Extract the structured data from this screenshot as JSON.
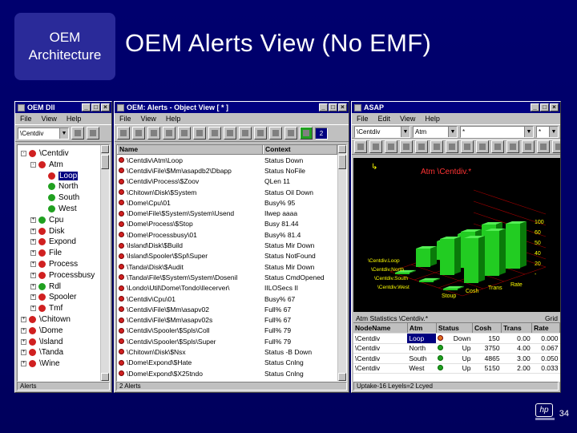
{
  "slide": {
    "architecture_box": [
      "OEM",
      "Architecture"
    ],
    "title": "OEM Alerts View (No EMF)",
    "page_number": "34"
  },
  "win_dll": {
    "title": "OEM Dll",
    "menu": [
      "File",
      "View",
      "Help"
    ],
    "combo": "\\Centdiv",
    "tree": [
      {
        "label": "\\Centdiv",
        "depth": 0,
        "expander": "-",
        "color": "#d02020"
      },
      {
        "label": "Atm",
        "depth": 1,
        "expander": "-",
        "color": "#d02020"
      },
      {
        "label": "Loop",
        "depth": 2,
        "color": "#d02020",
        "selected": true
      },
      {
        "label": "North",
        "depth": 2,
        "color": "#20a020"
      },
      {
        "label": "South",
        "depth": 2,
        "color": "#20a020"
      },
      {
        "label": "West",
        "depth": 2,
        "color": "#20a020"
      },
      {
        "label": "Cpu",
        "depth": 1,
        "expander": "+",
        "color": "#20a020"
      },
      {
        "label": "Disk",
        "depth": 1,
        "expander": "+",
        "color": "#d02020"
      },
      {
        "label": "Expond",
        "depth": 1,
        "expander": "+",
        "color": "#d02020"
      },
      {
        "label": "File",
        "depth": 1,
        "expander": "+",
        "color": "#d02020"
      },
      {
        "label": "Process",
        "depth": 1,
        "expander": "+",
        "color": "#d02020"
      },
      {
        "label": "Processbusy",
        "depth": 1,
        "expander": "+",
        "color": "#d02020"
      },
      {
        "label": "Rdl",
        "depth": 1,
        "expander": "+",
        "color": "#20a020"
      },
      {
        "label": "Spooler",
        "depth": 1,
        "expander": "+",
        "color": "#d02020"
      },
      {
        "label": "Tmf",
        "depth": 1,
        "expander": "+",
        "color": "#d02020"
      },
      {
        "label": "\\Chitown",
        "depth": 0,
        "expander": "+",
        "color": "#d02020"
      },
      {
        "label": "\\Dome",
        "depth": 0,
        "expander": "+",
        "color": "#d02020"
      },
      {
        "label": "\\Island",
        "depth": 0,
        "expander": "+",
        "color": "#d02020"
      },
      {
        "label": "\\Tanda",
        "depth": 0,
        "expander": "+",
        "color": "#d02020"
      },
      {
        "label": "\\Wine",
        "depth": 0,
        "expander": "+",
        "color": "#d02020"
      }
    ],
    "status": "Alerts"
  },
  "win_alerts": {
    "title": "OEM: Alerts - Object View [ * ]",
    "menu": [
      "File",
      "View",
      "Help"
    ],
    "toolbar_counter": "2",
    "columns": [
      "Name",
      "Context"
    ],
    "rows": [
      [
        "\\Centdiv\\Atm\\Loop",
        "Status Down"
      ],
      [
        "\\Centdiv\\File\\$Mm\\asapdb2\\Dbapp",
        "Status NoFile"
      ],
      [
        "\\Centdiv\\Process\\$Zoov",
        "QLen 11"
      ],
      [
        "\\Chitown\\Disk\\$System",
        "Status Oil Down"
      ],
      [
        "\\Dome\\Cpu\\01",
        "Busy% 95"
      ],
      [
        "\\Dome\\File\\$System\\System\\Usend",
        "Ilwep aaaa"
      ],
      [
        "\\Dome\\Process\\$Stop",
        "Busy 81.44"
      ],
      [
        "\\Dome\\Processbusy\\01",
        "Busy% 81.4"
      ],
      [
        "\\Island\\Disk\\$Build",
        "Status Mir Down"
      ],
      [
        "\\Island\\Spooler\\$Spl\\Super",
        "Status NotFound"
      ],
      [
        "\\Tanda\\Disk\\$Audit",
        "Status Mir Down"
      ],
      [
        "\\Tanda\\File\\$System\\System\\Dosenil",
        "Status CmdOpened"
      ],
      [
        "\\Londo\\Util\\Dome\\Tondo\\Ilecerver\\",
        "IILOSecs II"
      ],
      [
        "\\Centdiv\\Cpu\\01",
        "Busy% 67"
      ],
      [
        "\\Centdiv\\File\\$Mm\\asapv02",
        "Full% 67"
      ],
      [
        "\\Centdiv\\File\\$Mm\\asapv02s",
        "Full% 67"
      ],
      [
        "\\Centdiv\\Spooler\\$Spls\\Coll",
        "Full% 79"
      ],
      [
        "\\Centdiv\\Spooler\\$Spls\\Super",
        "Full% 79"
      ],
      [
        "\\Chitown\\Disk\\$Nsx",
        "Status -B Down"
      ],
      [
        "\\Dome\\Expond\\$Hate",
        "Status Cnlng"
      ],
      [
        "\\Dome\\Expond\\$X25tndo",
        "Status Cnlng"
      ]
    ],
    "status": "2 Alerts"
  },
  "win_asap": {
    "title": "ASAP",
    "menu": [
      "File",
      "Edit",
      "View",
      "Help"
    ],
    "combos": [
      "\\Centdiv",
      "Atm",
      "*",
      "*"
    ],
    "toolbar_label": "x1",
    "chart_title": "Atm \\Centdiv.*",
    "stats_title": "Atm Statistics \\Centdiv.*",
    "stats_grid": "Grid",
    "stats_columns": [
      "NodeName",
      "Atm",
      "Status",
      "Cosh",
      "Trans",
      "Rate"
    ],
    "stats_rows": [
      [
        "\\Centdiv",
        "Loop",
        "Down",
        "150",
        "0.00",
        "0.000"
      ],
      [
        "\\Centdiv",
        "North",
        "Up",
        "3750",
        "4.00",
        "0.067"
      ],
      [
        "\\Centdiv",
        "South",
        "Up",
        "4865",
        "3.00",
        "0.050"
      ],
      [
        "\\Centdiv",
        "West",
        "Up",
        "5150",
        "2.00",
        "0.033"
      ]
    ],
    "status": "Uptake-16  Leyels=2 Lcyed"
  },
  "chart_data": {
    "type": "bar",
    "title": "Atm \\Centdiv.*",
    "categories": [
      "\\Centdiv.Loop",
      "\\Centdiv.North",
      "\\Centdiv.South",
      "\\Centdiv.West"
    ],
    "series": [
      {
        "name": "Cosh",
        "values": [
          0.5,
          10,
          10,
          10
        ]
      },
      {
        "name": "Trans",
        "values": [
          0.5,
          20,
          20,
          20
        ]
      },
      {
        "name": "Rate",
        "values": [
          0.5,
          25,
          25,
          25
        ]
      }
    ],
    "yticks": [
      "100",
      "60",
      "50",
      "40",
      "20",
      "-"
    ],
    "axis_labels": [
      "Stoup",
      "Cosh",
      "Trans",
      "Rate"
    ],
    "colors": {
      "bar": "#22cc22",
      "bar_dark": "#0a7a0a",
      "grid": "#a00000",
      "text": "#ffff00",
      "title": "#ff3333"
    }
  }
}
